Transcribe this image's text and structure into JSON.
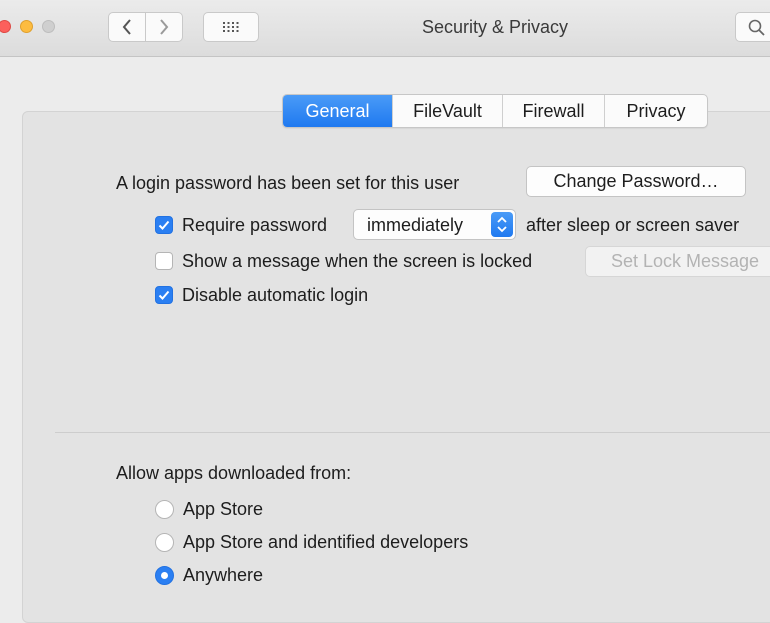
{
  "window": {
    "title": "Security & Privacy"
  },
  "tabs": [
    {
      "label": "General",
      "active": true
    },
    {
      "label": "FileVault",
      "active": false
    },
    {
      "label": "Firewall",
      "active": false
    },
    {
      "label": "Privacy",
      "active": false
    }
  ],
  "general": {
    "login_password_text": "A login password has been set for this user",
    "change_password_label": "Change Password…",
    "require_password": {
      "label": "Require password",
      "checked": true
    },
    "require_password_select": {
      "value": "immediately"
    },
    "after_sleep_text": "after sleep or screen saver",
    "show_message": {
      "label": "Show a message when the screen is locked",
      "checked": false
    },
    "set_lock_message_label": "Set Lock Message",
    "disable_auto_login": {
      "label": "Disable automatic login",
      "checked": true
    }
  },
  "allow_apps": {
    "heading": "Allow apps downloaded from:",
    "options": [
      {
        "label": "App Store",
        "selected": false
      },
      {
        "label": "App Store and identified developers",
        "selected": false
      },
      {
        "label": "Anywhere",
        "selected": true
      }
    ]
  },
  "colors": {
    "accent": "#2b7ff2",
    "close": "#fc605c",
    "minimize": "#fdbc40",
    "zoom_inactive": "#cfcfcf"
  }
}
